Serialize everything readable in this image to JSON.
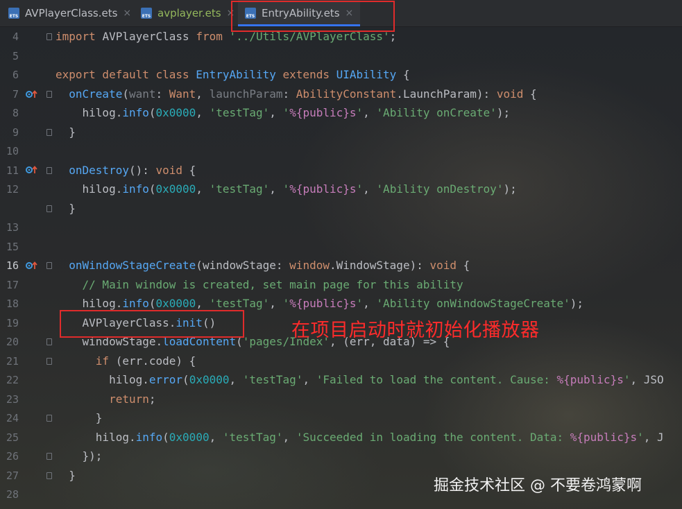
{
  "tabs": [
    {
      "label": "AVPlayerClass.ets",
      "modified": false,
      "active": false,
      "icon": "ets-file-icon"
    },
    {
      "label": "avplayer.ets",
      "modified": true,
      "active": false,
      "icon": "ets-file-icon"
    },
    {
      "label": "EntryAbility.ets",
      "modified": false,
      "active": true,
      "icon": "ets-file-icon"
    }
  ],
  "close_glyph": "×",
  "line_numbers": [
    "4",
    "5",
    "6",
    "7",
    "8",
    "9",
    "10",
    "11",
    "12",
    "13",
    "15",
    "16",
    "17",
    "18",
    "19",
    "20",
    "21",
    "22",
    "23",
    "24",
    "25",
    "26",
    "27",
    "28"
  ],
  "current_line": "16",
  "code": {
    "l4": {
      "kw1": "import",
      "name": "AVPlayerClass",
      "kw2": "from",
      "path": "'../Utils/AVPlayerClass'",
      "semi": ";"
    },
    "l6": {
      "kw1": "export default class",
      "name": "EntryAbility",
      "kw2": "extends",
      "base": "UIAbility",
      "brace": "{"
    },
    "l7": {
      "fn": "onCreate",
      "open": "(",
      "p1": "want",
      "colon1": ": ",
      "t1": "Want",
      "sep": ", ",
      "p2": "launchParam",
      "colon2": ": ",
      "t2": "AbilityConstant",
      "dot": ".",
      "t3": "LaunchParam",
      "close": "): ",
      "ret": "void",
      "brace": "{"
    },
    "l8": {
      "obj": "hilog",
      "dot": ".",
      "method": "info",
      "open": "(",
      "num": "0x0000",
      "c1": ", ",
      "s1": "'testTag'",
      "c2": ", ",
      "s2a": "'",
      "s2b": "%{public}s",
      "s2c": "'",
      "c3": ", ",
      "s3": "'Ability onCreate'",
      "end": ");"
    },
    "l9": {
      "brace": "}"
    },
    "l11": {
      "fn": "onDestroy",
      "close": "(): ",
      "ret": "void",
      "brace": "{"
    },
    "l12": {
      "obj": "hilog",
      "dot": ".",
      "method": "info",
      "open": "(",
      "num": "0x0000",
      "c1": ", ",
      "s1": "'testTag'",
      "c2": ", ",
      "s2a": "'",
      "s2b": "%{public}s",
      "s2c": "'",
      "c3": ", ",
      "s3": "'Ability onDestroy'",
      "end": ");"
    },
    "l13": {
      "brace": "}"
    },
    "l16": {
      "fn": "onWindowStageCreate",
      "open": "(",
      "p1": "windowStage",
      "colon1": ": ",
      "t1": "window",
      "dot": ".",
      "t2": "WindowStage",
      "close": "): ",
      "ret": "void",
      "brace": "{"
    },
    "l17": {
      "comment": "// Main window is created, set main page for this ability"
    },
    "l18": {
      "obj": "hilog",
      "dot": ".",
      "method": "info",
      "open": "(",
      "num": "0x0000",
      "c1": ", ",
      "s1": "'testTag'",
      "c2": ", ",
      "s2a": "'",
      "s2b": "%{public}s",
      "s2c": "'",
      "c3": ", ",
      "s3": "'Ability onWindowStageCreate'",
      "end": ");"
    },
    "l19": {
      "cls": "AVPlayerClass",
      "dot": ".",
      "method": "init",
      "call": "()"
    },
    "l20": {
      "obj": "windowStage",
      "dot": ".",
      "method": "loadContent",
      "open": "(",
      "s1": "'pages/Index'",
      "c1": ", ",
      "args": "(err, data) => ",
      "brace": "{"
    },
    "l21": {
      "kw": "if",
      "cond": " (err.code) ",
      "brace": "{"
    },
    "l22": {
      "obj": "hilog",
      "dot": ".",
      "method": "error",
      "open": "(",
      "num": "0x0000",
      "c1": ", ",
      "s1": "'testTag'",
      "c2": ", ",
      "s2": "'Failed to load the content. Cause: ",
      "s2v": "%{public}s",
      "s2e": "'",
      "tail": ", JSO"
    },
    "l23": {
      "kw": "return",
      "semi": ";"
    },
    "l24": {
      "brace": "}"
    },
    "l25": {
      "obj": "hilog",
      "dot": ".",
      "method": "info",
      "open": "(",
      "num": "0x0000",
      "c1": ", ",
      "s1": "'testTag'",
      "c2": ", ",
      "s2": "'Succeeded in loading the content. Data: ",
      "s2v": "%{public}s",
      "s2e": "'",
      "tail": ", J"
    },
    "l26": {
      "close": "});"
    },
    "l27": {
      "brace": "}"
    }
  },
  "annotation": "在项目启动时就初始化播放器",
  "watermark": "掘金技术社区 @ 不要卷鸿蒙啊",
  "colors": {
    "highlight": "#e02b2b",
    "annotation": "#ff2b2b",
    "active_tab_underline": "#3574f0"
  }
}
